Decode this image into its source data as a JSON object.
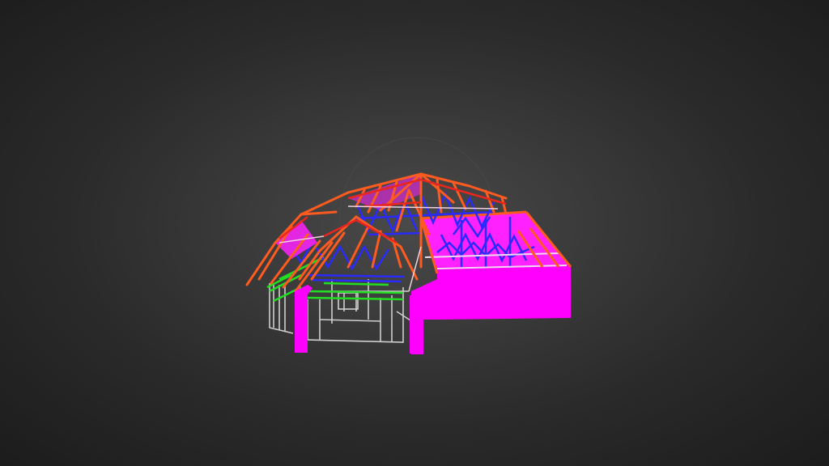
{
  "viewer": {
    "model": "house-frame-3d",
    "colors": {
      "background_center": "#4a4a4a",
      "background_edge": "#1c1c1c",
      "rafter": "#ff5a1f",
      "rafter_alt": "#e8261e",
      "purlin": "#ff8a20",
      "web_member": "#2a2aff",
      "wall_frame": "#d0d0d0",
      "top_plate": "#22dd22",
      "garage_wall": "#ff00ff",
      "roof_fill": "#ff22ff"
    }
  }
}
